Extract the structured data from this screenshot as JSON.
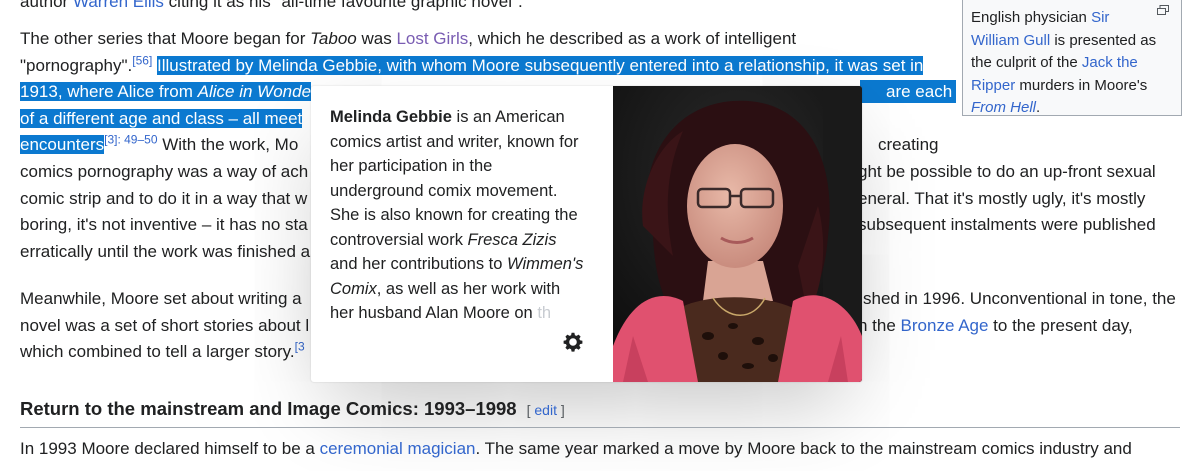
{
  "top_line": {
    "pre": "author ",
    "link": "Warren Ellis",
    "post": " citing it as his \"all-time favourite graphic novel\"."
  },
  "para1": {
    "l1_pre": "The other series that Moore began for ",
    "l1_taboo": "Taboo",
    "l1_mid": " was ",
    "l1_link": "Lost Girls",
    "l1_post": ", which he described as a work of intelligent",
    "l2_pre": "\"pornography\".",
    "l2_ref": "[56]",
    "l2_space": " ",
    "l2_sel": "Illustrated by Melinda Gebbie, with whom Moore subsequently entered into a relationship, it was set in",
    "l3_sel_a": "1913, where Alice from ",
    "l3_sel_italic": "Alice in Wonde",
    "l3_right": "are each",
    "l4_sel": "of a different age and class – all meet",
    "l5_sel": "encounters",
    "l5_ref": "[3]: 49–50",
    "l5_post": " With the work, Mo",
    "l5_right": "creating",
    "l6_left": "comics pornography was a way of ach",
    "l6_right": "ght be possible to do an up-front sexual",
    "l7_left": "comic strip and to do it in a way that w",
    "l7_right": "eneral. That it's mostly ugly, it's mostly",
    "l8_left": "boring, it's not inventive – it has no sta",
    "l8_right": "subsequent instalments were published",
    "l9_left": "erratically until the work was finished a"
  },
  "para2": {
    "l1_left": "Meanwhile, Moore set about writing a ",
    "l1_right": "shed in 1996. Unconventional in tone, the",
    "l2_left": "novel was a set of short stories about l",
    "l2_right_pre": "n the ",
    "l2_link": "Bronze Age",
    "l2_right_post": " to the present day,",
    "l3_left": "which combined to tell a larger story.",
    "l3_ref": "[3"
  },
  "infobox": {
    "l1_pre": "English physician ",
    "l1_link": "Sir",
    "l2_link": "William Gull",
    "l2_post": " is presented as",
    "l3_pre": "the culprit of the ",
    "l3_link": "Jack the",
    "l4_link": "Ripper",
    "l4_post": " murders in Moore's",
    "l5_link": "From Hell",
    "l5_post": "."
  },
  "popup": {
    "name": "Melinda Gebbie",
    "l1_post": " is an American",
    "l2": "comics artist and writer, known for",
    "l3": "her participation in the",
    "l4": "underground comix movement.",
    "l5": "She is also known for creating the",
    "l6_pre": "controversial work ",
    "l6_italic": "Fresca Zizis",
    "l7_pre": "and her contributions to ",
    "l7_italic": "Wimmen's",
    "l8_italic": "Comix",
    "l8_post": ", as well as her work with",
    "l9_pre": "her husband Alan Moore on ",
    "l9_fade": "th",
    "settings_icon": "gear-icon",
    "image": "portrait-photo"
  },
  "section": {
    "heading": "Return to the mainstream and Image Comics: 1993–1998",
    "edit_open": "[ ",
    "edit_label": "edit",
    "edit_close": " ]"
  },
  "last_para": {
    "pre": "In 1993 Moore declared himself to be a ",
    "link": "ceremonial magician",
    "post": ". The same year marked a move by Moore back to the mainstream comics industry and"
  },
  "colors": {
    "link": "#3366cc",
    "visited": "#795cb2",
    "selection": "#0b79d0",
    "text": "#202122"
  }
}
